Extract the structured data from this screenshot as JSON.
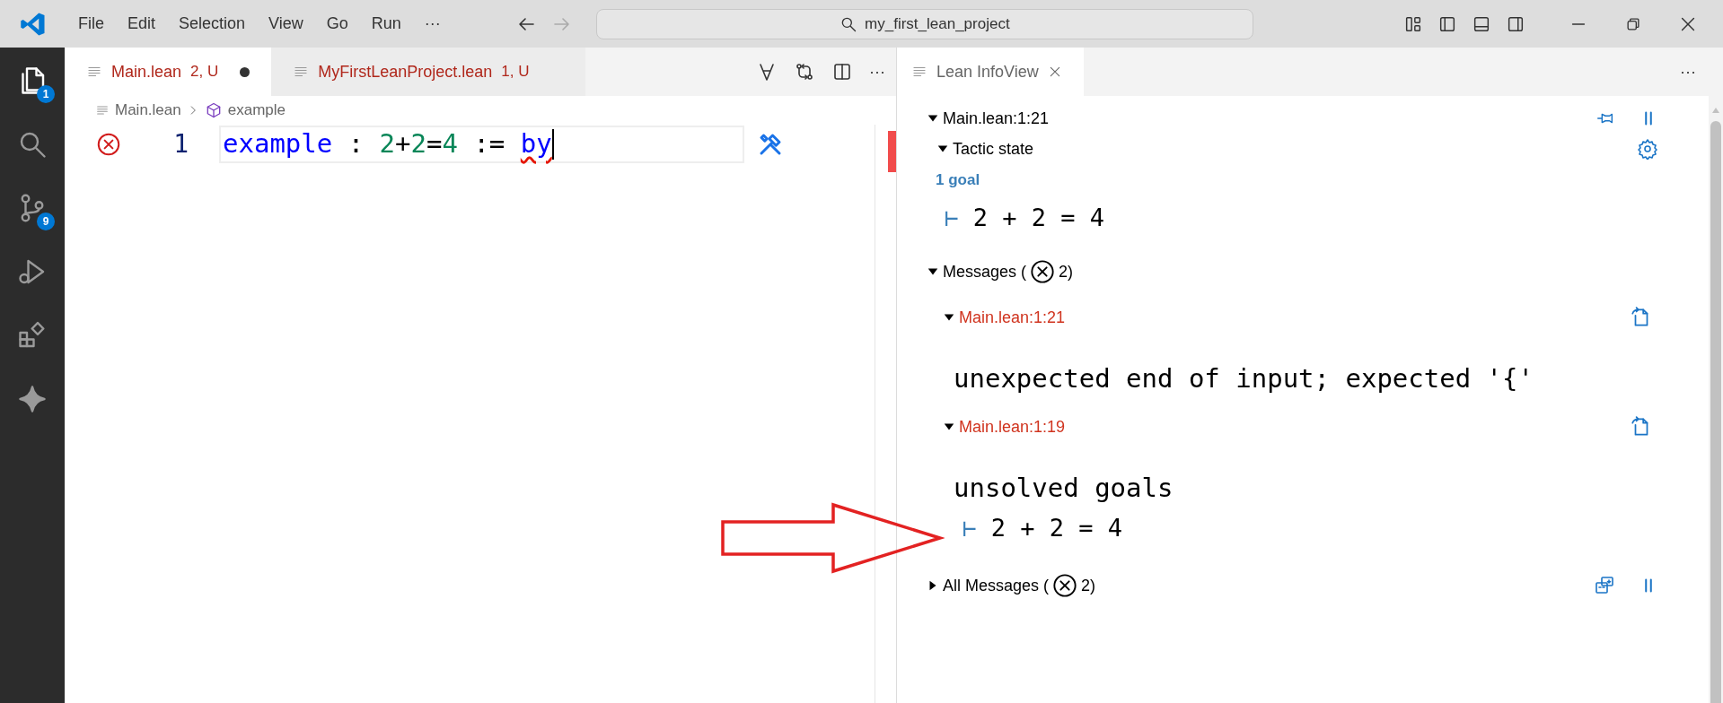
{
  "window": {
    "menu": [
      "File",
      "Edit",
      "Selection",
      "View",
      "Go",
      "Run",
      "···"
    ],
    "search": "my_first_lean_project"
  },
  "activity_bar": [
    {
      "kind": "files",
      "badge": "1"
    },
    {
      "kind": "search"
    },
    {
      "kind": "source-control",
      "badge": "9"
    },
    {
      "kind": "run"
    },
    {
      "kind": "extensions"
    },
    {
      "kind": "sparkle"
    }
  ],
  "editor": {
    "tabs": [
      {
        "label": "Main.lean",
        "status": "2, U",
        "selected": true,
        "modified": true
      },
      {
        "label": "MyFirstLeanProject.lean",
        "status": "1, U",
        "selected": false,
        "modified": false
      }
    ],
    "more": "···",
    "breadcrumb": [
      "Main.lean",
      "example"
    ],
    "lines": [
      {
        "number": "1",
        "error": true,
        "tokens": [
          {
            "kind": "keyword",
            "text": "example"
          },
          {
            "kind": "plain",
            "text": " : "
          },
          {
            "kind": "number",
            "text": "2"
          },
          {
            "kind": "plain",
            "text": "+"
          },
          {
            "kind": "number",
            "text": "2"
          },
          {
            "kind": "plain",
            "text": "="
          },
          {
            "kind": "number",
            "text": "4"
          },
          {
            "kind": "plain",
            "text": " := "
          },
          {
            "kind": "keyword",
            "text": "by",
            "error": true
          }
        ]
      }
    ]
  },
  "infoview": {
    "tab": "Lean InfoView",
    "more": "···",
    "position": {
      "label": "Main.lean:1:21",
      "expanded": true
    },
    "tactic_state": {
      "label": "Tactic state",
      "expanded": true,
      "goal_count": "1 goal",
      "goals": [
        {
          "turnstile": "⊢",
          "expr": "2 + 2 = 4"
        }
      ]
    },
    "messages": {
      "prefix": "Messages (",
      "suffix": "2)",
      "expanded": true,
      "items": [
        {
          "location": "Main.lean:1:21",
          "expanded": true,
          "text": "unexpected end of input; expected '{'"
        },
        {
          "location": "Main.lean:1:19",
          "expanded": true,
          "text": "unsolved goals",
          "goal": {
            "turnstile": "⊢",
            "expr": "2 + 2 = 4"
          }
        }
      ]
    },
    "all_messages": {
      "prefix": "All Messages (",
      "suffix": "2)",
      "expanded": false
    }
  }
}
